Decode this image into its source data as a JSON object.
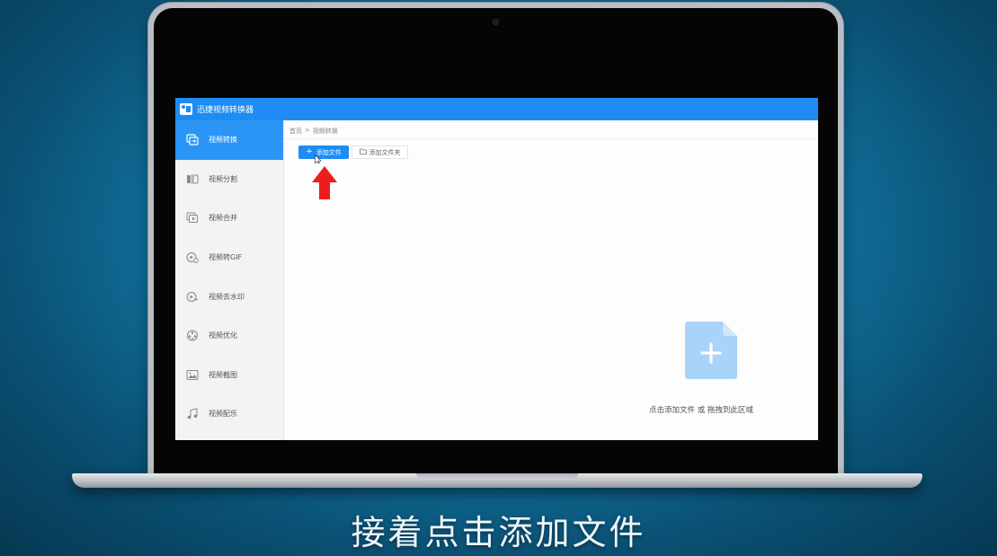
{
  "app": {
    "title": "迅捷视频转换器"
  },
  "sidebar": {
    "items": [
      {
        "label": "视频转换",
        "icon": "convert-icon",
        "active": true
      },
      {
        "label": "视频分割",
        "icon": "split-icon",
        "active": false
      },
      {
        "label": "视频合并",
        "icon": "merge-icon",
        "active": false
      },
      {
        "label": "视频转GIF",
        "icon": "gif-icon",
        "active": false
      },
      {
        "label": "视频去水印",
        "icon": "watermark-icon",
        "active": false
      },
      {
        "label": "视频优化",
        "icon": "optimize-icon",
        "active": false
      },
      {
        "label": "视频截图",
        "icon": "screenshot-icon",
        "active": false
      },
      {
        "label": "视频配乐",
        "icon": "music-icon",
        "active": false
      }
    ]
  },
  "breadcrumb": {
    "home": "首页",
    "separator": ">",
    "current": "视频转换"
  },
  "toolbar": {
    "add_file_label": "添加文件",
    "add_folder_label": "添加文件夹"
  },
  "dropzone": {
    "hint": "点击添加文件 或 拖拽到此区域"
  },
  "subtitle": "接着点击添加文件",
  "colors": {
    "accent": "#1e8cf2",
    "sidebar_active": "#2a95f4",
    "arrow": "#ee1c1c",
    "drop_icon": "#a9d3f8"
  }
}
